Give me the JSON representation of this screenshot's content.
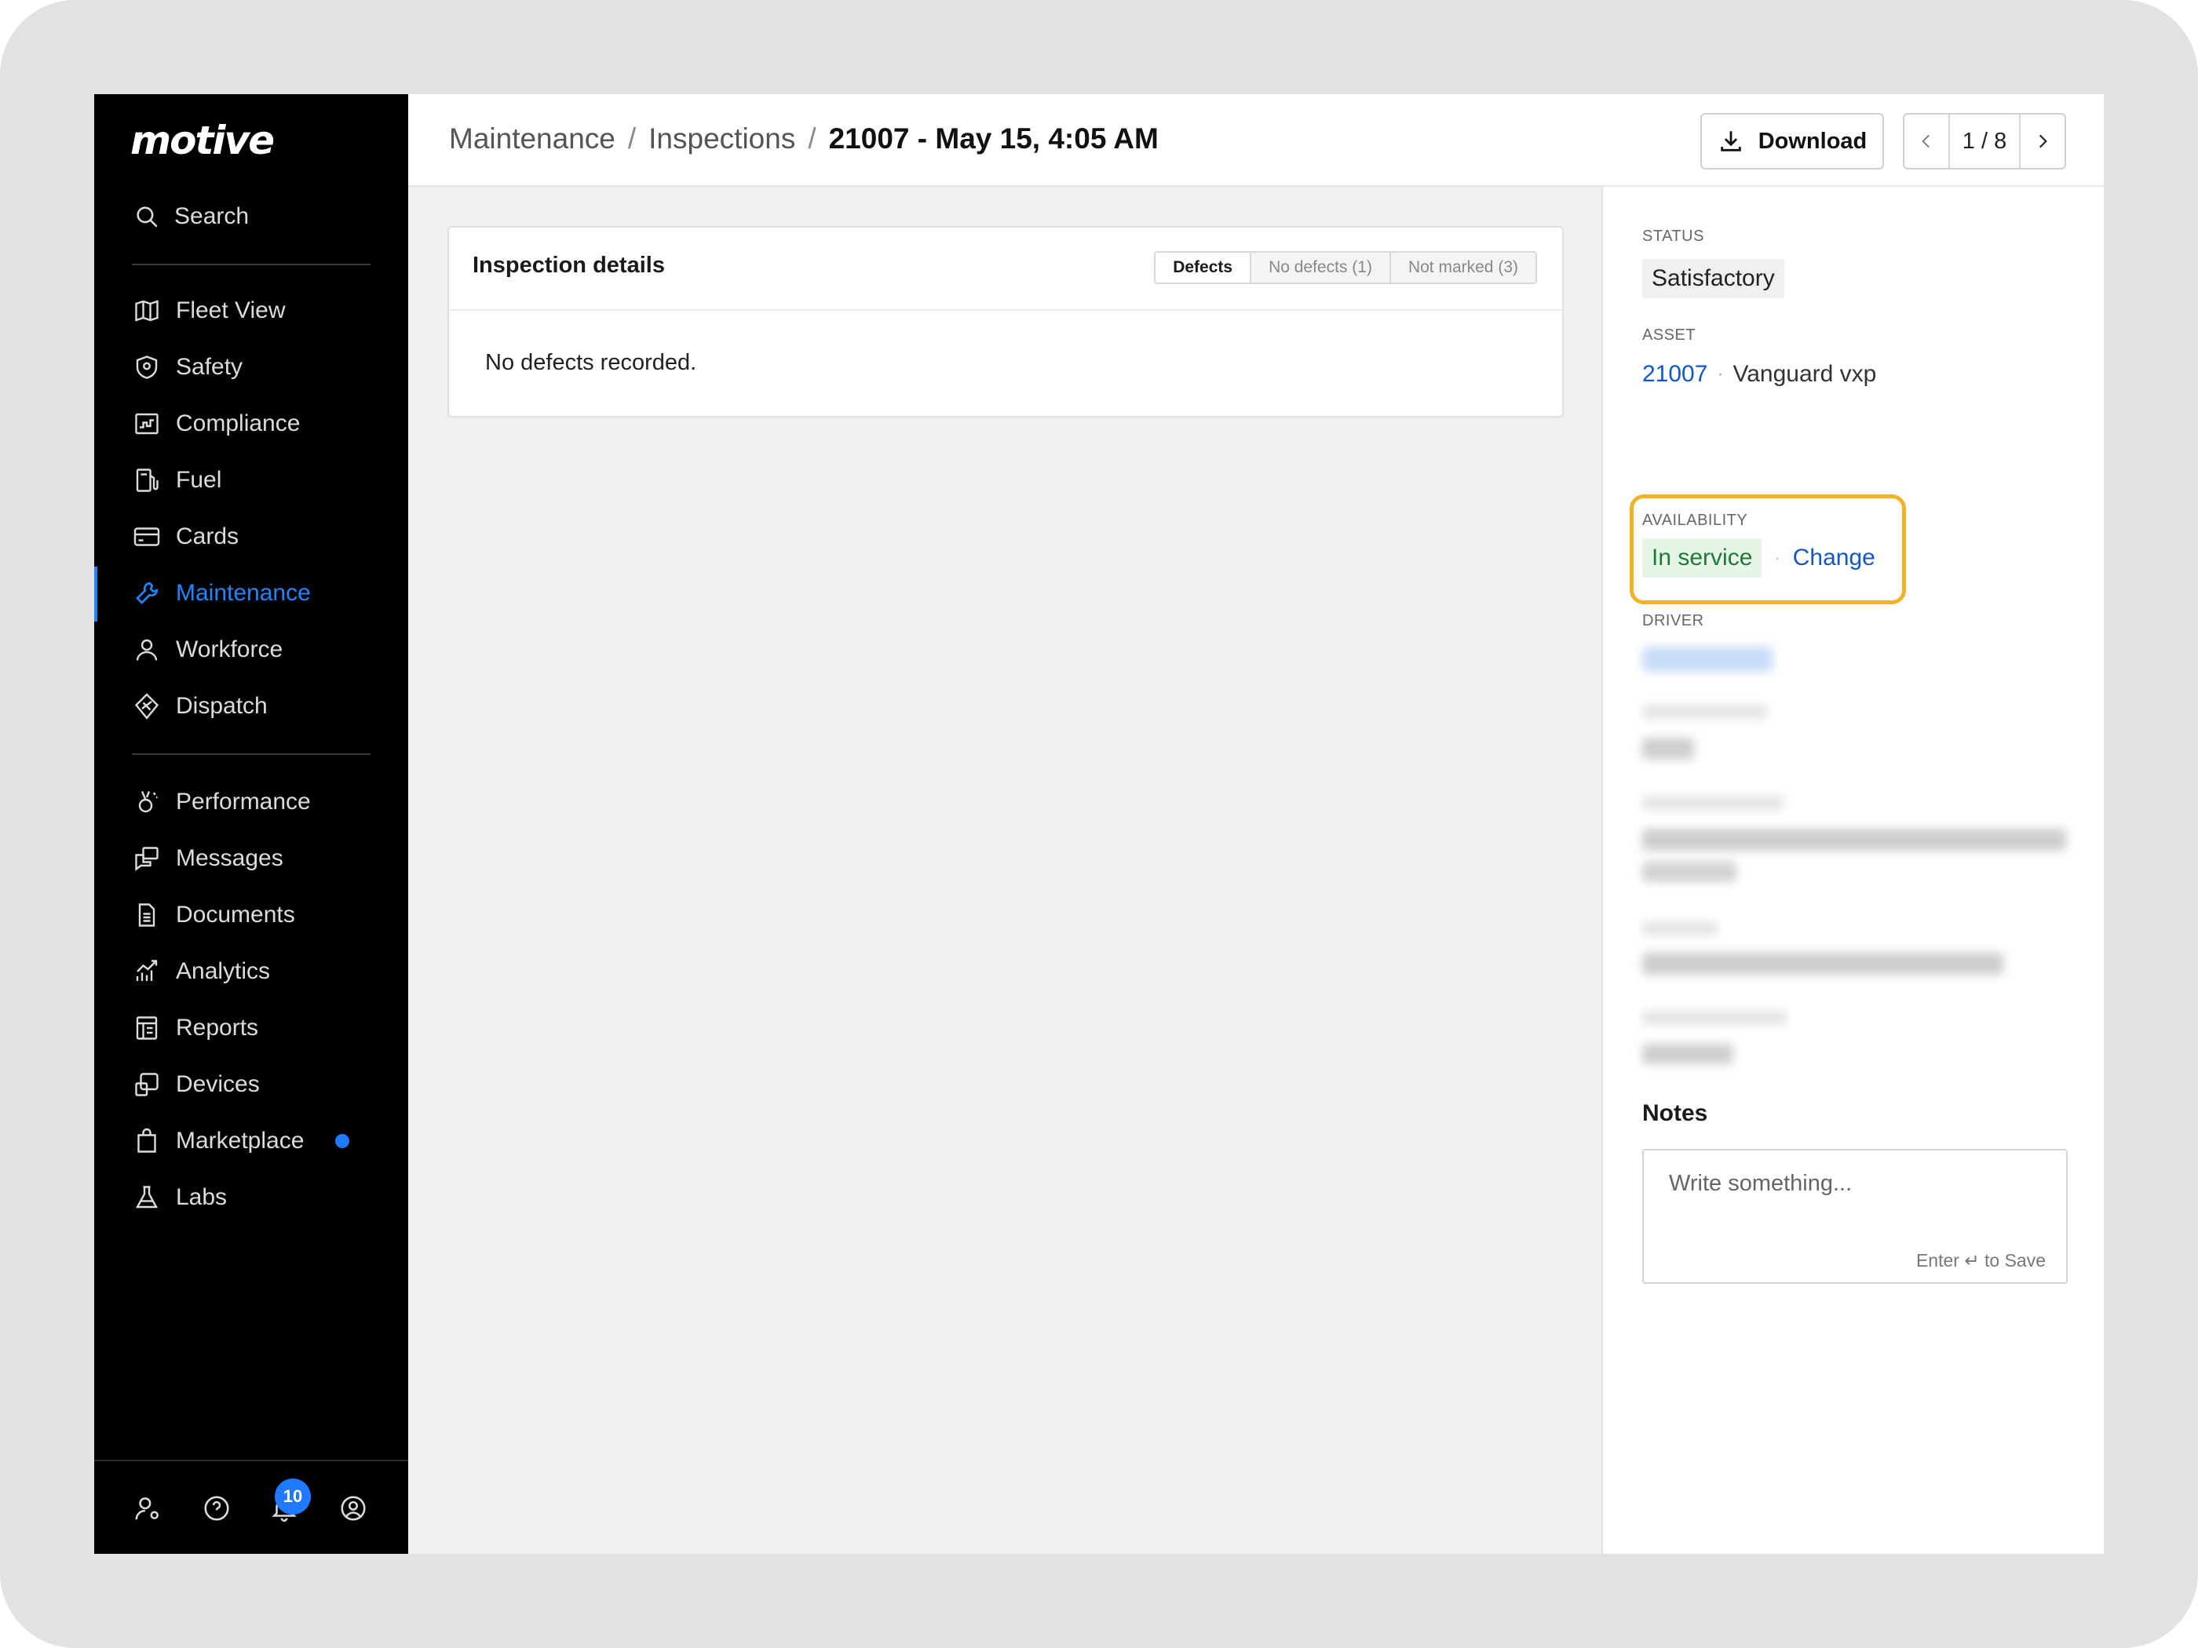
{
  "sidebar": {
    "logo": "motive",
    "search_label": "Search",
    "items": [
      {
        "label": "Fleet View"
      },
      {
        "label": "Safety"
      },
      {
        "label": "Compliance"
      },
      {
        "label": "Fuel"
      },
      {
        "label": "Cards"
      },
      {
        "label": "Maintenance",
        "active": true
      },
      {
        "label": "Workforce"
      },
      {
        "label": "Dispatch"
      },
      {
        "label": "Performance"
      },
      {
        "label": "Messages"
      },
      {
        "label": "Documents"
      },
      {
        "label": "Analytics"
      },
      {
        "label": "Reports"
      },
      {
        "label": "Devices"
      },
      {
        "label": "Marketplace"
      },
      {
        "label": "Labs"
      }
    ],
    "notification_count": "10"
  },
  "header": {
    "breadcrumb": [
      "Maintenance",
      "Inspections",
      "21007 - May 15, 4:05 AM"
    ],
    "separator": "/",
    "download_label": "Download",
    "pager": "1 / 8"
  },
  "main": {
    "card_title": "Inspection details",
    "filters": [
      "Defects",
      "No defects (1)",
      "Not marked (3)"
    ],
    "empty_message": "No defects recorded."
  },
  "panel": {
    "status_label": "STATUS",
    "status_value": "Satisfactory",
    "asset_label": "ASSET",
    "asset_id": "21007",
    "asset_separator": "·",
    "asset_name": "Vanguard vxp",
    "availability_label": "AVAILABILITY",
    "availability_value": "In service",
    "availability_separator": "·",
    "change_label": "Change",
    "driver_label": "DRIVER",
    "notes_title": "Notes",
    "notes_placeholder": "Write something...",
    "notes_hint": "Enter ↵ to Save"
  },
  "colors": {
    "accent": "#1f86ff",
    "link": "#1457c4",
    "highlight": "#f2b32a",
    "in_service_bg": "#e6f5e8",
    "in_service_text": "#1f7a35"
  }
}
